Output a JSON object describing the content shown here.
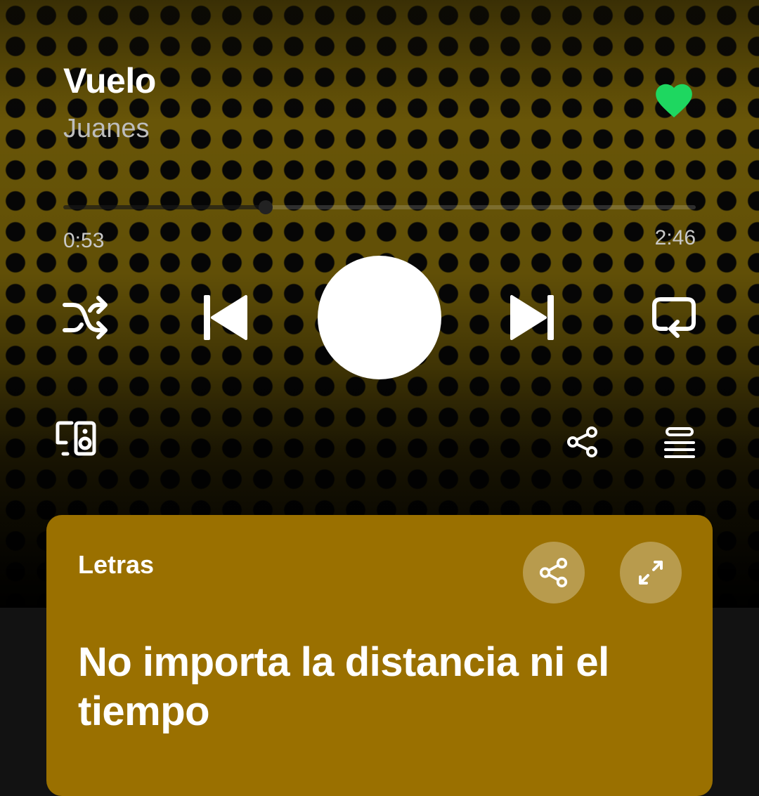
{
  "track": {
    "title": "Vuelo",
    "artist": "Juanes",
    "liked": true
  },
  "playback": {
    "elapsed": "0:53",
    "duration": "2:46",
    "progress_fraction": 0.32
  },
  "controls": {
    "shuffle_icon": "shuffle-icon",
    "previous_icon": "skip-previous-icon",
    "play_icon": "play-pause-button",
    "next_icon": "skip-next-icon",
    "repeat_icon": "repeat-icon",
    "devices_icon": "connect-devices-icon",
    "share_icon": "share-icon",
    "queue_icon": "queue-icon"
  },
  "lyrics": {
    "label": "Letras",
    "current_line": "No importa la distancia ni el tiempo",
    "share_icon": "share-icon",
    "expand_icon": "expand-icon"
  },
  "colors": {
    "accent": "#1ed760",
    "card": "#9a7000",
    "background": "#121212"
  }
}
